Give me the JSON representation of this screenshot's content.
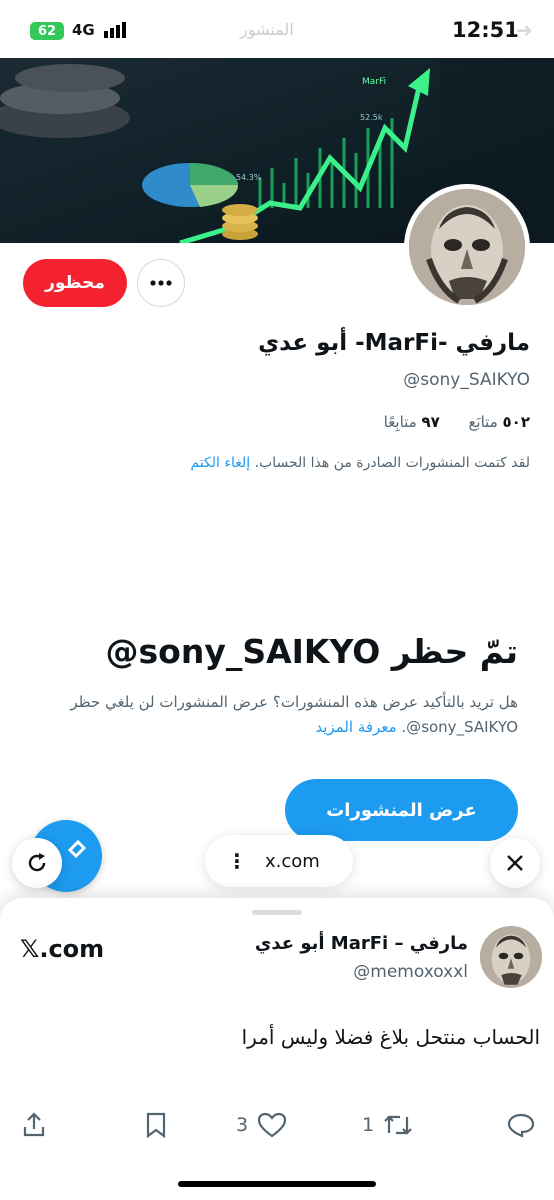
{
  "status_bar": {
    "time": "12:51",
    "battery": "62",
    "network": "4G",
    "faded_title": "المنشور"
  },
  "profile": {
    "blocked_label": "محظور",
    "display_name": "مارفي -MarFi- أبو عدي",
    "handle": "@sony_SAIKYO",
    "following_count": "٥٠٢",
    "following_label": "متابَع",
    "followers_count": "٩٧",
    "followers_label": "متابِعًا",
    "muted_note": "لقد كتمت المنشورات الصادرة من هذا الحساب.",
    "unmute_label": "إلغاء الكتم"
  },
  "blocked_notice": {
    "title": "تمّ حظر sony_SAIKYO@",
    "description_line1": "هل تريد بالتأكيد عرض هذه المنشورات؟ عرض المنشورات لن يلغي حظر",
    "description_line2": "sony_SAIKYO@.",
    "learn_more": "معرفة المزيد",
    "view_posts_label": "عرض المنشورات"
  },
  "browser": {
    "url": "x.com",
    "menu_glyph": "⋮",
    "close_glyph": "✕"
  },
  "sheet": {
    "site": "𝕏.com",
    "tweet_name": "مارفي – MarFi أبو عدي",
    "tweet_handle": "@memoxoxxl",
    "tweet_text": "الحساب منتحل بلاغ فضلا وليس أمرا",
    "reply_count": "",
    "retweet_count": "1",
    "like_count": "3"
  },
  "colors": {
    "accent": "#1d9bf0",
    "blocked_red": "#f4212e",
    "secondary_text": "#536471",
    "battery_green": "#34c759"
  },
  "icons": [
    "signal-icon",
    "more-dots-icon",
    "refresh-icon",
    "compose-icon",
    "close-icon",
    "reply-icon",
    "retweet-icon",
    "like-icon",
    "bookmark-icon",
    "share-icon"
  ]
}
